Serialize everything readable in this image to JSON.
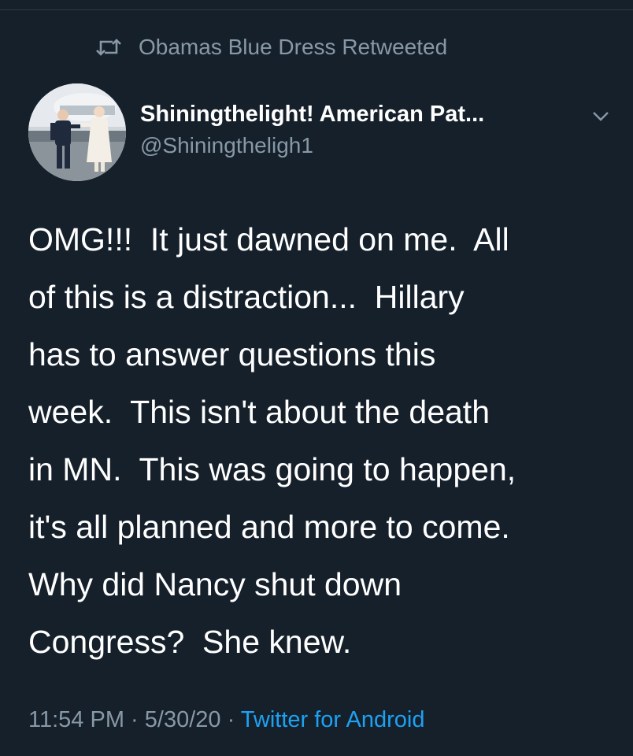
{
  "retweet": {
    "icon": "retweet-icon",
    "text": "Obamas Blue Dress Retweeted"
  },
  "author": {
    "avatar_icon": "profile-photo",
    "display_name": "Shiningthelight! American Pat...",
    "handle": "@Shiningtheligh1",
    "menu_icon": "chevron-down-icon"
  },
  "tweet": {
    "lines": [
      "OMG!!!  It just dawned on me.  All",
      "of this is a distraction...  Hillary",
      "has to answer questions this",
      "week.  This isn't about the death",
      "in MN.  This was going to happen,",
      "it's all planned and more to come.",
      "Why did Nancy shut down",
      "Congress?  She knew."
    ]
  },
  "meta": {
    "time": "11:54 PM",
    "separator": " · ",
    "date": "5/30/20",
    "source": "Twitter for Android"
  },
  "colors": {
    "background": "#15202b",
    "secondary_text": "#8899a6",
    "link": "#1da1f2"
  }
}
